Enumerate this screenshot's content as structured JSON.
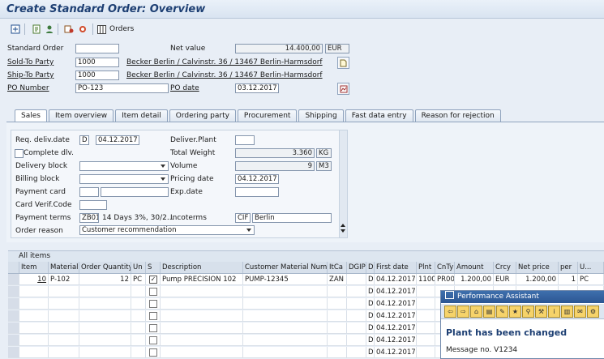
{
  "window": {
    "title": "Create Standard Order: Overview"
  },
  "toolbar": {
    "orders_label": "Orders"
  },
  "header": {
    "standard_order_label": "Standard Order",
    "net_value_label": "Net value",
    "net_value": "14.400,00",
    "currency": "EUR",
    "sold_to_label": "Sold-To Party",
    "sold_to_value": "1000",
    "sold_to_text": "Becker Berlin / Calvinstr. 36 / 13467 Berlin-Harmsdorf",
    "ship_to_label": "Ship-To Party",
    "ship_to_value": "1000",
    "ship_to_text": "Becker Berlin / Calvinstr. 36 / 13467 Berlin-Harmsdorf",
    "po_number_label": "PO Number",
    "po_number_value": "PO-123",
    "po_date_label": "PO date",
    "po_date_value": "03.12.2017"
  },
  "tabs": [
    "Sales",
    "Item overview",
    "Item detail",
    "Ordering party",
    "Procurement",
    "Shipping",
    "Fast data entry",
    "Reason for rejection"
  ],
  "sales": {
    "req_deliv_label": "Req. deliv.date",
    "req_deliv_type": "D",
    "req_deliv_date": "04.12.2017",
    "deliver_plant_label": "Deliver.Plant",
    "complete_dlv_label": "Complete dlv.",
    "total_weight_label": "Total Weight",
    "total_weight_value": "3.360",
    "weight_unit": "KG",
    "delivery_block_label": "Delivery block",
    "volume_label": "Volume",
    "volume_value": "9",
    "volume_unit": "M3",
    "billing_block_label": "Billing block",
    "pricing_date_label": "Pricing date",
    "pricing_date_value": "04.12.2017",
    "payment_card_label": "Payment card",
    "exp_date_label": "Exp.date",
    "card_verif_label": "Card Verif.Code",
    "payment_terms_label": "Payment terms",
    "payment_terms_code": "ZB01",
    "payment_terms_text": "14 Days 3%, 30/2...",
    "incoterms_label": "Incoterms",
    "incoterms_code": "CIF",
    "incoterms_place": "Berlin",
    "order_reason_label": "Order reason",
    "order_reason_value": "Customer recommendation"
  },
  "grid": {
    "title": "All items",
    "columns": [
      "Item",
      "Material",
      "Order Quantity",
      "Un",
      "S",
      "Description",
      "Customer Material Numb",
      "ItCa",
      "DGIP",
      "D",
      "First date",
      "Plnt",
      "CnTy",
      "Amount",
      "Crcy",
      "Net price",
      "per",
      "U..."
    ],
    "first_row": {
      "item": "10",
      "material": "P-102",
      "qty": "12",
      "unit": "PC",
      "description": "Pump PRECISION 102",
      "customer_material": "PUMP-12345",
      "itca": "ZAN",
      "d": "D",
      "first_date": "04.12.2017",
      "plant": "1100",
      "cnty": "PR00",
      "amount": "1.200,00",
      "crcy": "EUR",
      "net_price": "1.200,00",
      "per": "1",
      "u": "PC"
    },
    "empty_rows": [
      {
        "d": "D",
        "first_date": "04.12.2017"
      },
      {
        "d": "D",
        "first_date": "04.12.2017"
      },
      {
        "d": "D",
        "first_date": "04.12.2017"
      },
      {
        "d": "D",
        "first_date": "04.12.2017"
      },
      {
        "d": "D",
        "first_date": "04.12.2017"
      },
      {
        "d": "D",
        "first_date": "04.12.2017"
      }
    ]
  },
  "perf_assistant": {
    "title": "Performance Assistant",
    "heading": "Plant has been changed",
    "message": "Message no. V1234"
  }
}
